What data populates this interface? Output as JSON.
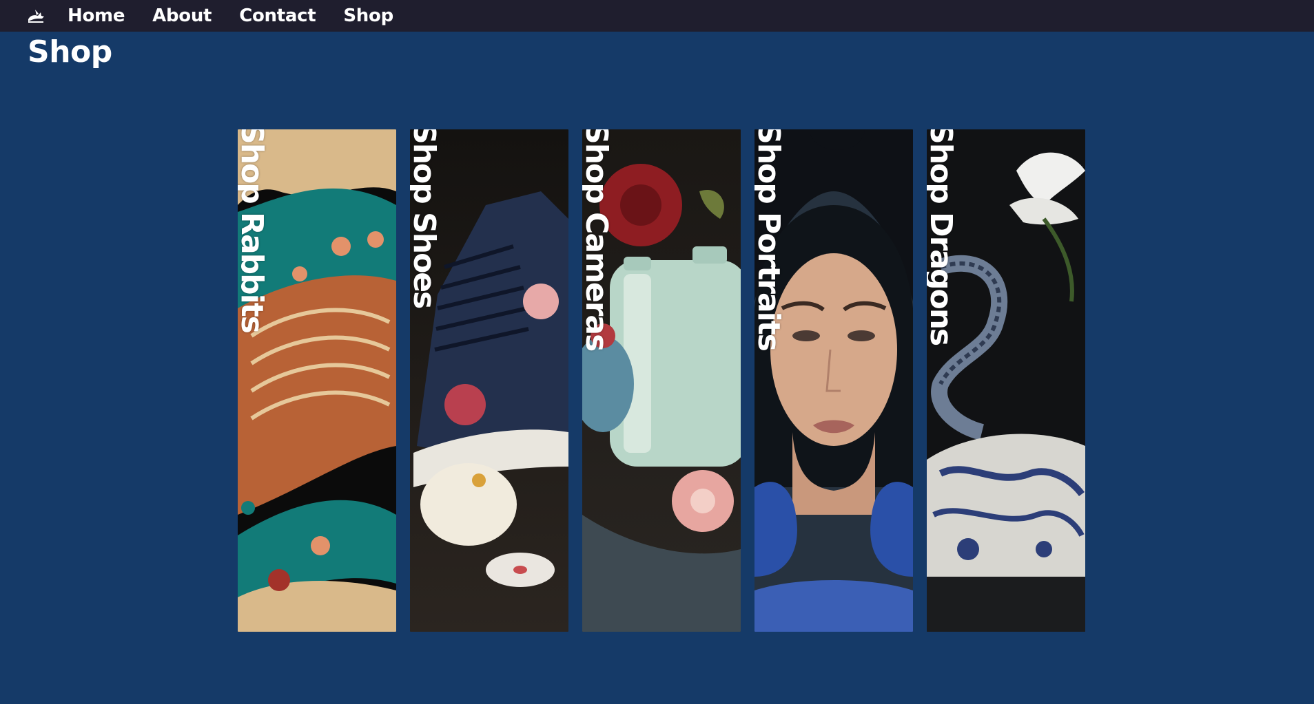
{
  "nav": {
    "logo_icon": "rabbit-logo-icon",
    "links": [
      {
        "label": "Home"
      },
      {
        "label": "About"
      },
      {
        "label": "Contact"
      },
      {
        "label": "Shop"
      }
    ]
  },
  "page": {
    "title": "Shop"
  },
  "panels": [
    {
      "label": "Shop Rabbits"
    },
    {
      "label": "Shop Shoes"
    },
    {
      "label": "Shop Cameras"
    },
    {
      "label": "Shop Portraits"
    },
    {
      "label": "Shop Dragons"
    }
  ],
  "colors": {
    "nav_bg": "#1f1e2e",
    "page_bg": "#153a68",
    "text": "#ffffff"
  }
}
